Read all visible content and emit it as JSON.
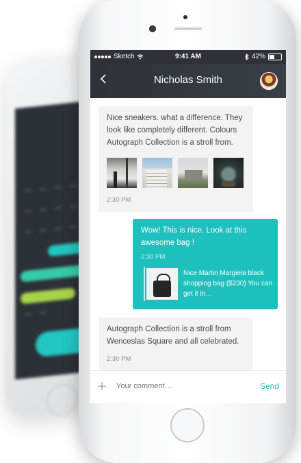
{
  "status_bar": {
    "carrier": "Sketch",
    "time": "9:41 AM",
    "battery": "42%"
  },
  "header": {
    "title": "Nicholas Smith"
  },
  "messages": [
    {
      "type": "incoming",
      "text": "Nice sneakers. what a difference. They look like completely different. Colours Autograph Collection is a stroll from.",
      "time": "2:30 PM"
    },
    {
      "type": "outgoing",
      "text": "Wow! This is nice. Look at this awesome bag !",
      "time": "2:30 PM",
      "product": {
        "text": "Nice Martin Margiela black shopping bag ($230) You can get it in…"
      }
    },
    {
      "type": "incoming",
      "text": "Autograph Collection is a stroll from Wenceslas Square and all celebrated.",
      "time": "2:30 PM"
    }
  ],
  "composer": {
    "placeholder": "Your comment…",
    "send_label": "Send"
  },
  "icons": {
    "back": "chevron-left-icon",
    "add": "plus-icon",
    "wifi": "wifi-icon",
    "bluetooth": "bluetooth-icon",
    "battery": "battery-icon"
  },
  "colors": {
    "accent": "#1ec0bd",
    "navbar": "#2e3238",
    "incoming_bubble": "#f3f3f3"
  }
}
